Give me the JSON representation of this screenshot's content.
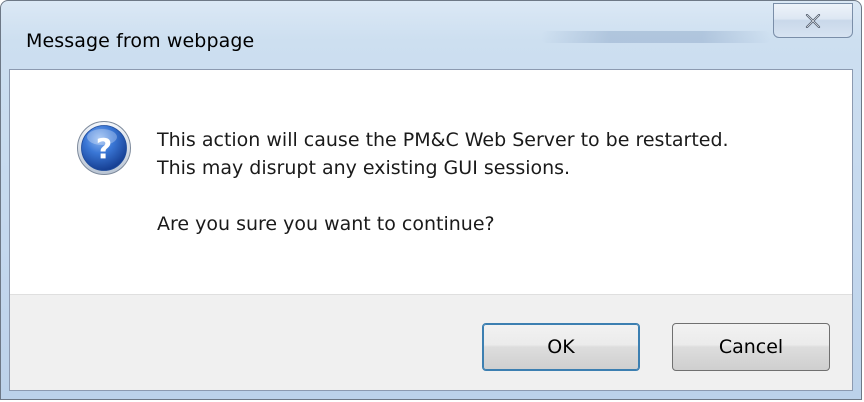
{
  "dialog": {
    "title": "Message from webpage",
    "close_icon": "close-x-icon",
    "icon": "question-icon",
    "icon_color": "#2a64c5",
    "message_lines": [
      "This action will cause the PM&C Web Server to be restarted.",
      "This may disrupt any existing GUI sessions."
    ],
    "question": "Are you sure you want to continue?",
    "buttons": {
      "ok_label": "OK",
      "cancel_label": "Cancel"
    }
  }
}
